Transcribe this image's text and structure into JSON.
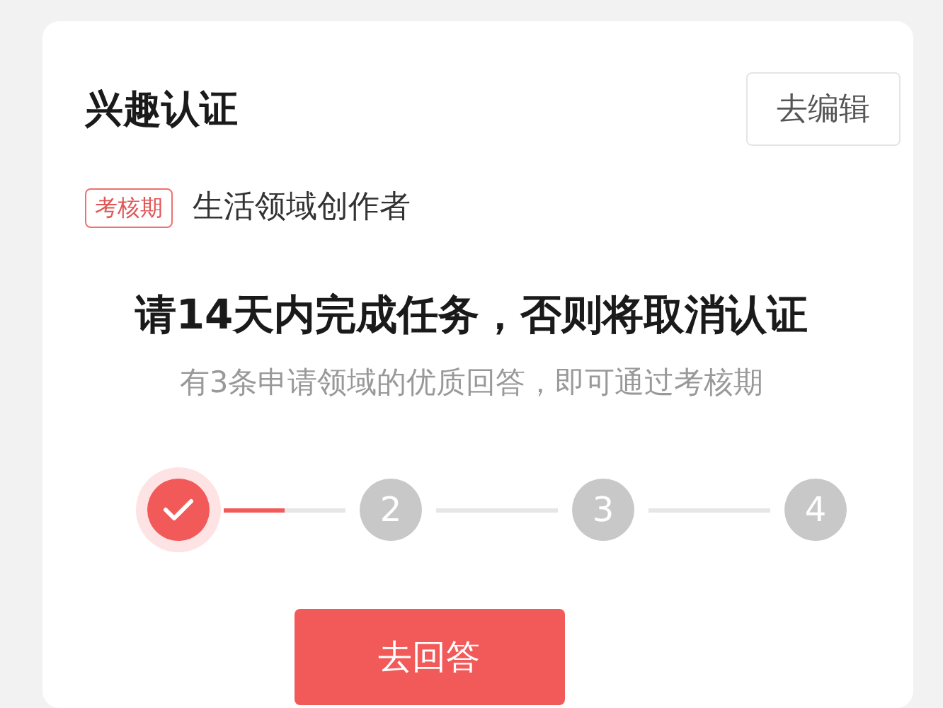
{
  "card": {
    "title": "兴趣认证",
    "edit_button": "去编辑",
    "badge": "考核期",
    "domain": "生活领域创作者",
    "heading": "请14天内完成任务，否则将取消认证",
    "subtitle": "有3条申请领域的优质回答，即可通过考核期",
    "steps": [
      {
        "done": true
      },
      {
        "label": "2",
        "done": false
      },
      {
        "label": "3",
        "done": false
      },
      {
        "label": "4",
        "done": false
      }
    ],
    "current_connector": {
      "level": 0.5
    },
    "answer_button": "去回答"
  }
}
